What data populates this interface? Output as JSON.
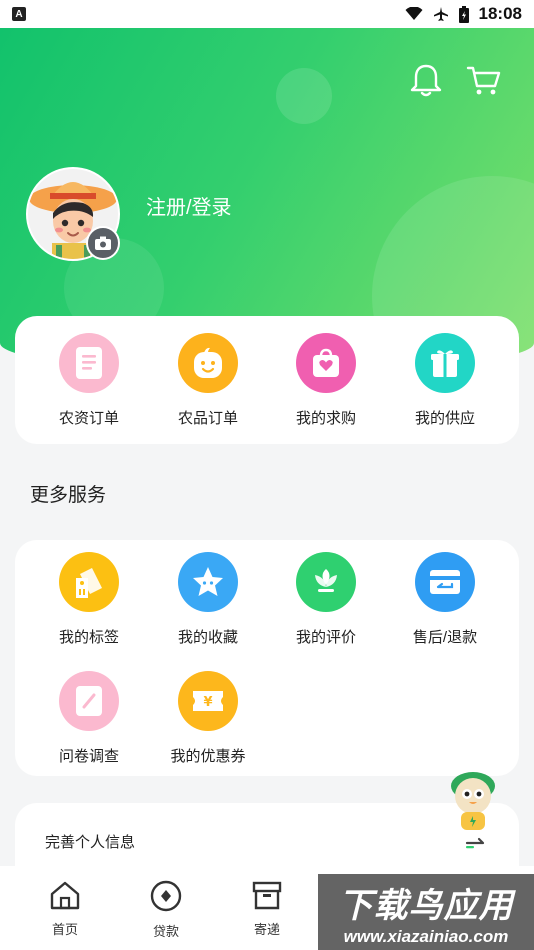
{
  "status_bar": {
    "app_badge": "A",
    "time": "18:08"
  },
  "header": {
    "login_text": "注册/登录"
  },
  "orders": [
    {
      "label": "农资订单",
      "icon": "document-icon",
      "color": "#fbb9cf"
    },
    {
      "label": "农品订单",
      "icon": "fruit-icon",
      "color": "#fdb21c"
    },
    {
      "label": "我的求购",
      "icon": "heart-bag-icon",
      "color": "#f05fb0"
    },
    {
      "label": "我的供应",
      "icon": "gift-icon",
      "color": "#22d6c6"
    }
  ],
  "more_services": {
    "title": "更多服务",
    "items": [
      {
        "label": "我的标签",
        "icon": "tag-icon",
        "color": "#fcc012"
      },
      {
        "label": "我的收藏",
        "icon": "star-icon",
        "color": "#3aa8f5"
      },
      {
        "label": "我的评价",
        "icon": "flower-icon",
        "color": "#2fd070"
      },
      {
        "label": "售后/退款",
        "icon": "refund-card-icon",
        "color": "#2f9df3"
      },
      {
        "label": "问卷调查",
        "icon": "survey-icon",
        "color": "#fbb9cf"
      },
      {
        "label": "我的优惠券",
        "icon": "coupon-icon",
        "color": "#fdb71c"
      }
    ]
  },
  "profile": {
    "label": "完善个人信息"
  },
  "tabs": [
    {
      "label": "首页",
      "icon": "home-icon"
    },
    {
      "label": "贷款",
      "icon": "loan-icon"
    },
    {
      "label": "寄递",
      "icon": "package-icon"
    }
  ],
  "watermark": {
    "cn": "下载鸟应用",
    "en": "www.xiazainiao.com"
  }
}
